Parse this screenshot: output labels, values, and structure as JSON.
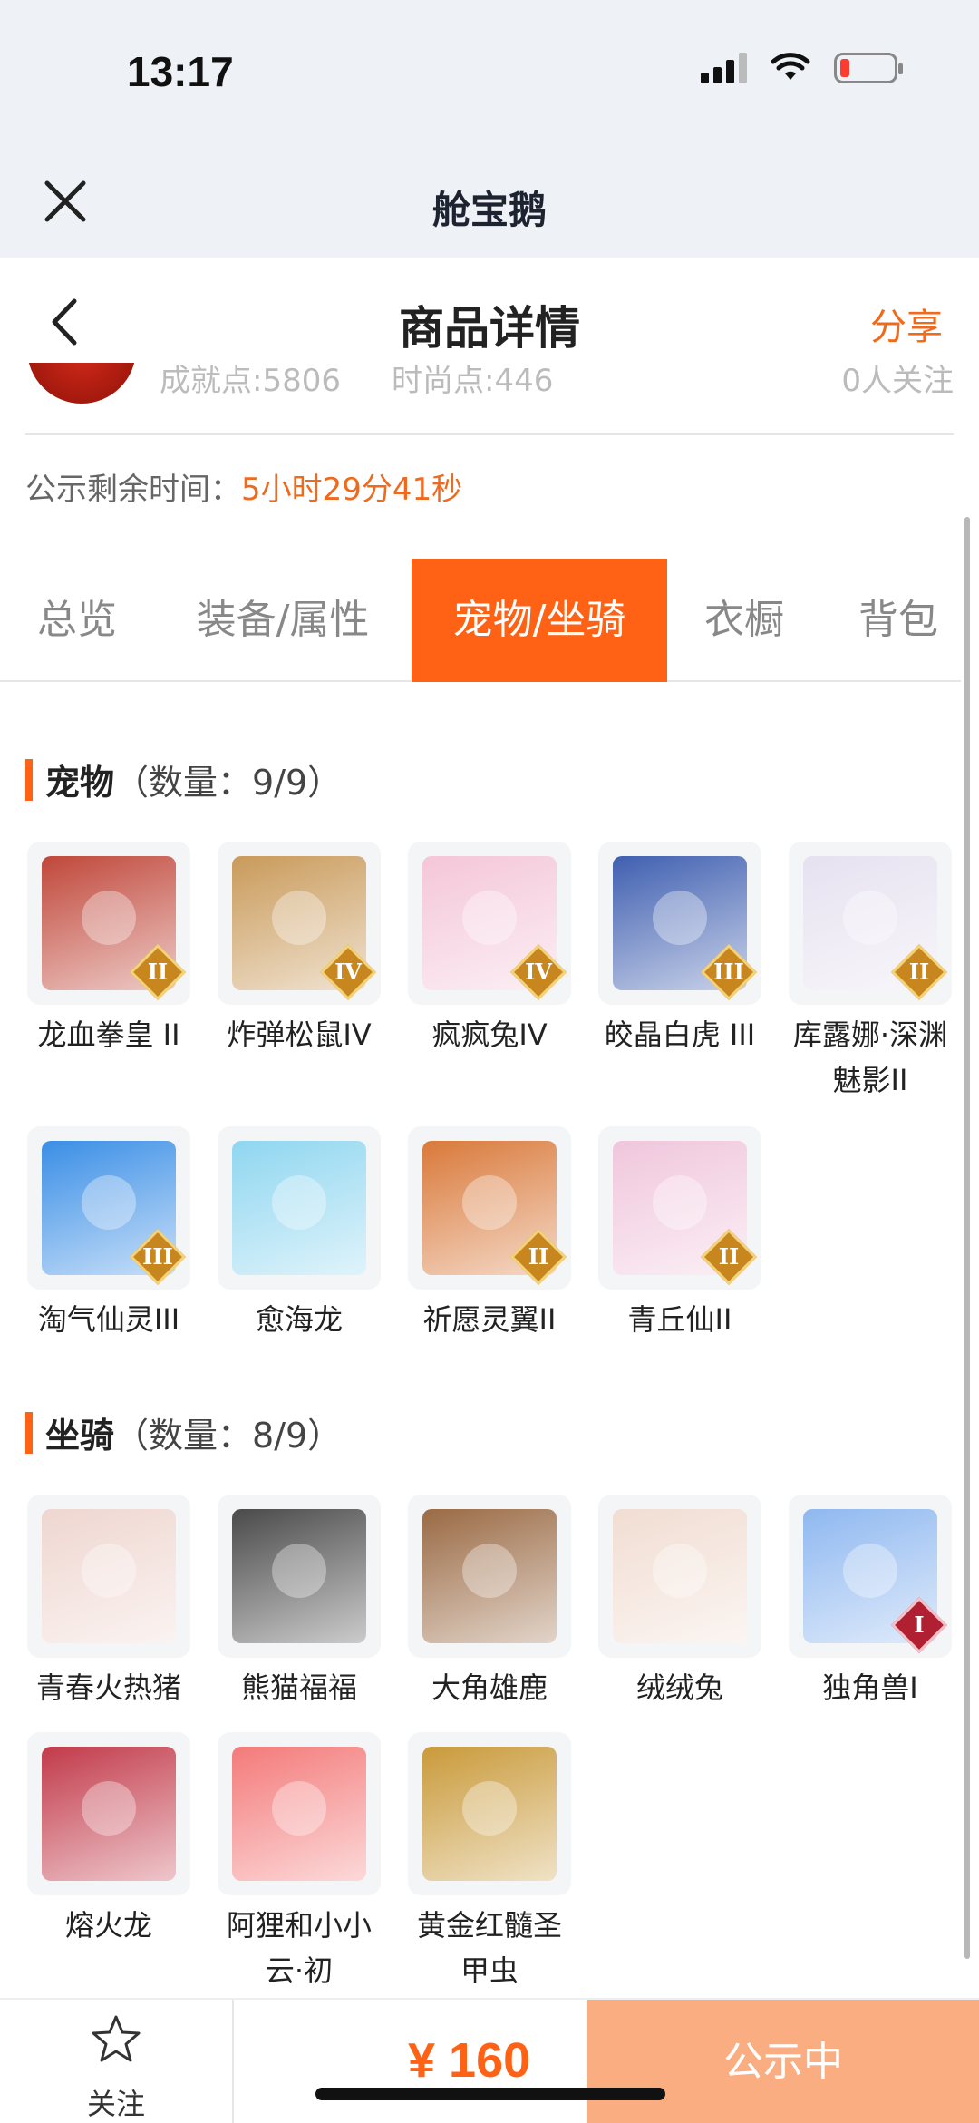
{
  "status_bar": {
    "time": "13:17"
  },
  "mini_header": {
    "title": "舱宝鹅"
  },
  "nav": {
    "title": "商品详情",
    "share": "分享"
  },
  "peek": {
    "achievement": "成就点:5806",
    "fashion": "时尚点:446",
    "followers": "0人关注"
  },
  "countdown": {
    "label": "公示剩余时间：",
    "value": "5小时29分41秒"
  },
  "tabs": [
    {
      "label": "总览"
    },
    {
      "label": "装备/属性"
    },
    {
      "label": "宠物/坐骑",
      "active": true
    },
    {
      "label": "衣橱"
    },
    {
      "label": "背包"
    }
  ],
  "pets": {
    "title": "宠物",
    "count": "（数量：9/9）",
    "items": [
      {
        "label": "龙血拳皇 II",
        "badge": "II",
        "color": "#c0473a"
      },
      {
        "label": "炸弹松鼠IV",
        "badge": "IV",
        "color": "#c99a5a"
      },
      {
        "label": "疯疯兔IV",
        "badge": "IV",
        "color": "#f4c6d8"
      },
      {
        "label": "皎晶白虎 III",
        "badge": "III",
        "color": "#3f5fb0"
      },
      {
        "label": "库露娜·深渊魅影II",
        "badge": "II",
        "color": "#e6e1f0"
      },
      {
        "label": "淘气仙灵III",
        "badge": "III",
        "color": "#3a8ee6"
      },
      {
        "label": "愈海龙",
        "badge": "",
        "color": "#8fd6f0"
      },
      {
        "label": "祈愿灵翼II",
        "badge": "II",
        "color": "#d9793a"
      },
      {
        "label": "青丘仙II",
        "badge": "II",
        "color": "#f0c6dc"
      }
    ]
  },
  "mounts": {
    "title": "坐骑",
    "count": "（数量：8/9）",
    "items": [
      {
        "label": "青春火热猪",
        "badge": "",
        "color": "#efd6d0"
      },
      {
        "label": "熊猫福福",
        "badge": "",
        "color": "#4a4a4a"
      },
      {
        "label": "大角雄鹿",
        "badge": "",
        "color": "#9a6a44"
      },
      {
        "label": "绒绒兔",
        "badge": "",
        "color": "#f1ddd2"
      },
      {
        "label": "独角兽I",
        "badge": "I",
        "color": "#8fb8f0"
      },
      {
        "label": "熔火龙",
        "badge": "",
        "color": "#c23a4a"
      },
      {
        "label": "阿狸和小小云·初",
        "badge": "",
        "color": "#f47a7a"
      },
      {
        "label": "黄金红髓圣甲虫",
        "badge": "",
        "color": "#c99a3a"
      }
    ]
  },
  "bottom": {
    "follow": "关注",
    "price": "¥ 160",
    "status": "公示中"
  },
  "colors": {
    "accent": "#ff6214",
    "share": "#f06a1d",
    "status_button": "#fbad82"
  },
  "icons": {
    "close": "close-icon",
    "back": "back-icon",
    "star": "star-icon"
  }
}
